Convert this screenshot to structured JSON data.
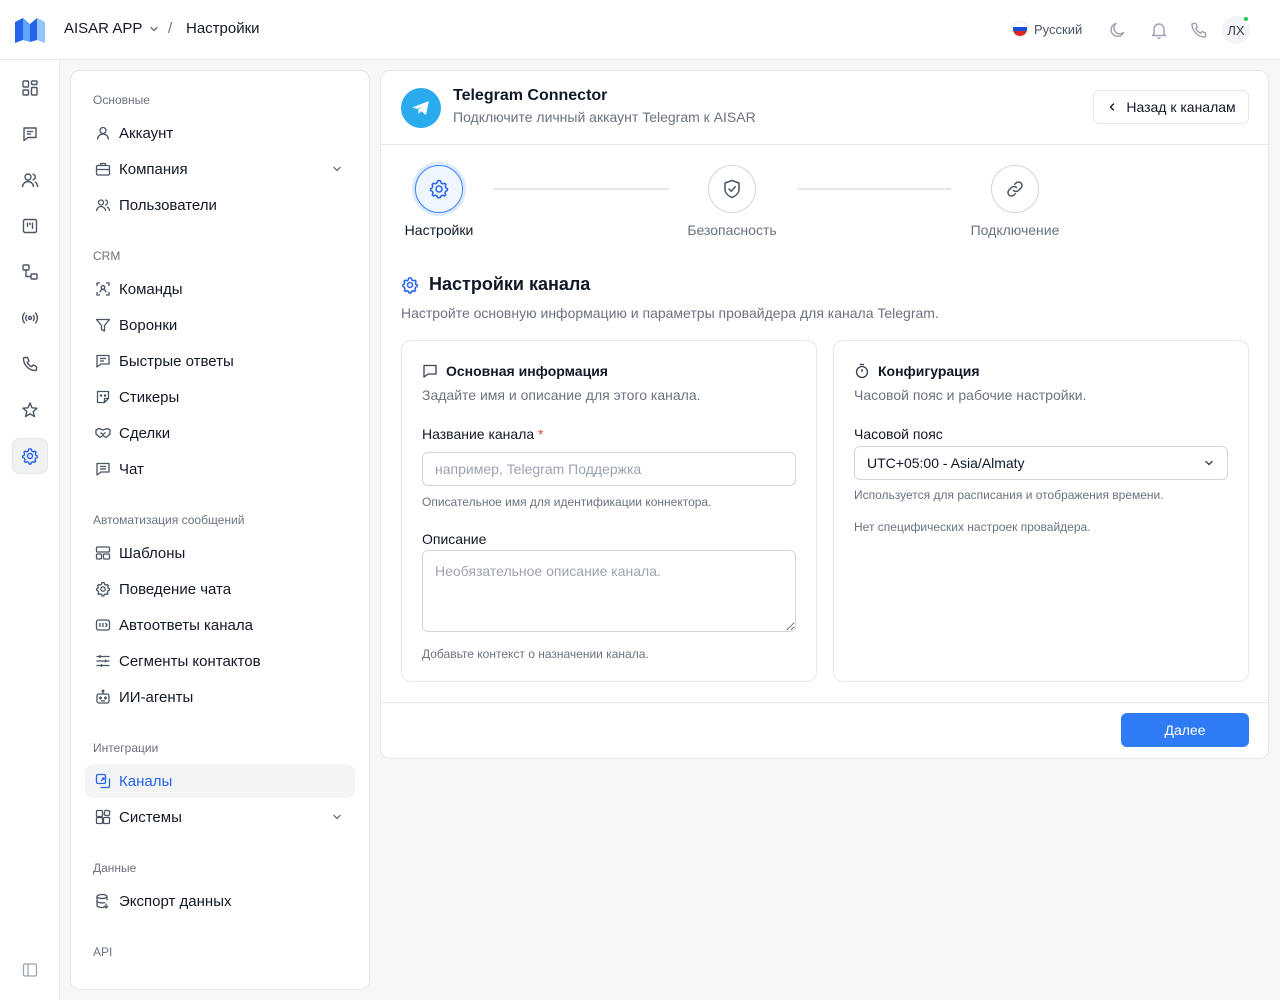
{
  "header": {
    "app_name": "AISAR APP",
    "breadcrumb_sep": "/",
    "breadcrumb_current": "Настройки",
    "language": "Русский",
    "avatar_initials": "ЛХ"
  },
  "rail": {
    "items": [
      "dashboard-icon",
      "messages-icon",
      "users-icon",
      "kanban-icon",
      "workflow-icon",
      "broadcast-icon",
      "phone-icon",
      "star-icon",
      "settings-icon"
    ],
    "active": "settings-icon"
  },
  "settings_nav": {
    "sections": [
      {
        "title": "Основные",
        "items": [
          {
            "label": "Аккаунт",
            "icon": "user-icon"
          },
          {
            "label": "Компания",
            "icon": "briefcase-icon",
            "expandable": true
          },
          {
            "label": "Пользователи",
            "icon": "users-icon"
          }
        ]
      },
      {
        "title": "CRM",
        "items": [
          {
            "label": "Команды",
            "icon": "team-icon"
          },
          {
            "label": "Воронки",
            "icon": "funnel-icon"
          },
          {
            "label": "Быстрые ответы",
            "icon": "quick-reply-icon"
          },
          {
            "label": "Стикеры",
            "icon": "sticker-icon"
          },
          {
            "label": "Сделки",
            "icon": "handshake-icon"
          },
          {
            "label": "Чат",
            "icon": "chat-icon"
          }
        ]
      },
      {
        "title": "Автоматизация сообщений",
        "items": [
          {
            "label": "Шаблоны",
            "icon": "template-icon"
          },
          {
            "label": "Поведение чата",
            "icon": "gear-icon"
          },
          {
            "label": "Автоответы канала",
            "icon": "autoreply-icon"
          },
          {
            "label": "Сегменты контактов",
            "icon": "sliders-icon"
          },
          {
            "label": "ИИ-агенты",
            "icon": "bot-icon"
          }
        ]
      },
      {
        "title": "Интеграции",
        "items": [
          {
            "label": "Каналы",
            "icon": "channels-icon",
            "active": true
          },
          {
            "label": "Системы",
            "icon": "blocks-icon",
            "expandable": true
          }
        ]
      },
      {
        "title": "Данные",
        "items": [
          {
            "label": "Экспорт данных",
            "icon": "database-icon"
          }
        ]
      },
      {
        "title": "API",
        "items": []
      }
    ]
  },
  "connector": {
    "title": "Telegram Connector",
    "subtitle": "Подключите личный аккаунт Telegram к AISAR",
    "back_label": "Назад к каналам"
  },
  "steps": [
    {
      "label": "Настройки",
      "icon": "gear-icon",
      "active": true
    },
    {
      "label": "Безопасность",
      "icon": "shield-icon",
      "active": false
    },
    {
      "label": "Подключение",
      "icon": "link-icon",
      "active": false
    }
  ],
  "section": {
    "title": "Настройки канала",
    "description": "Настройте основную информацию и параметры провайдера для канала Telegram."
  },
  "basic_info": {
    "title": "Основная информация",
    "description": "Задайте имя и описание для этого канала.",
    "name_label": "Название канала",
    "required_mark": "*",
    "name_placeholder": "например, Telegram Поддержка",
    "name_value": "",
    "name_hint": "Описательное имя для идентификации коннектора.",
    "desc_label": "Описание",
    "desc_placeholder": "Необязательное описание канала.",
    "desc_value": "",
    "desc_hint": "Добавьте контекст о назначении канала."
  },
  "config": {
    "title": "Конфигурация",
    "description": "Часовой пояс и рабочие настройки.",
    "tz_label": "Часовой пояс",
    "tz_value": "UTC+05:00 - Asia/Almaty",
    "tz_hint": "Используется для расписания и отображения времени.",
    "provider_note": "Нет специфических настроек провайдера."
  },
  "footer": {
    "next_label": "Далее"
  },
  "colors": {
    "accent": "#2f7bf5",
    "telegram": "#2AABEE",
    "required": "#ef4444"
  }
}
